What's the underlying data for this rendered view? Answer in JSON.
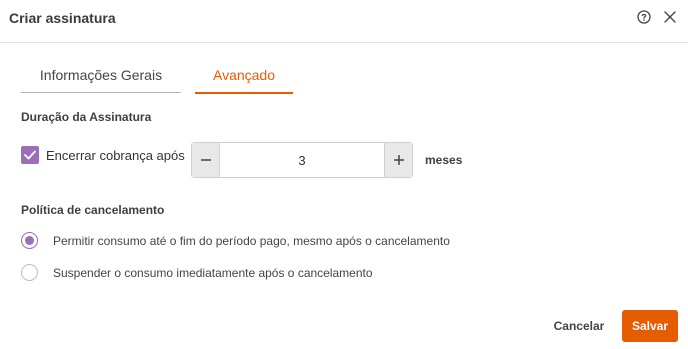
{
  "dialog": {
    "title": "Criar assinatura",
    "tabs": [
      {
        "label": "Informações Gerais",
        "active": false
      },
      {
        "label": "Avançado",
        "active": true
      }
    ]
  },
  "duration": {
    "section_title": "Duração da Assinatura",
    "checkbox_label": "Encerrar cobrança após",
    "checkbox_checked": true,
    "value": "3",
    "unit": "meses"
  },
  "policy": {
    "section_title": "Política de cancelamento",
    "options": [
      {
        "label": "Permitir consumo até o fim do período pago, mesmo após o cancelamento",
        "selected": true
      },
      {
        "label": "Suspender o consumo imediatamente após o cancelamento",
        "selected": false
      }
    ]
  },
  "footer": {
    "cancel_label": "Cancelar",
    "save_label": "Salvar"
  },
  "colors": {
    "accent": "#e65c00",
    "selection": "#9b6fb5"
  },
  "icons": {
    "help": "help-circle-icon",
    "close": "close-icon",
    "check": "check-icon",
    "minus": "minus-icon",
    "plus": "plus-icon"
  }
}
